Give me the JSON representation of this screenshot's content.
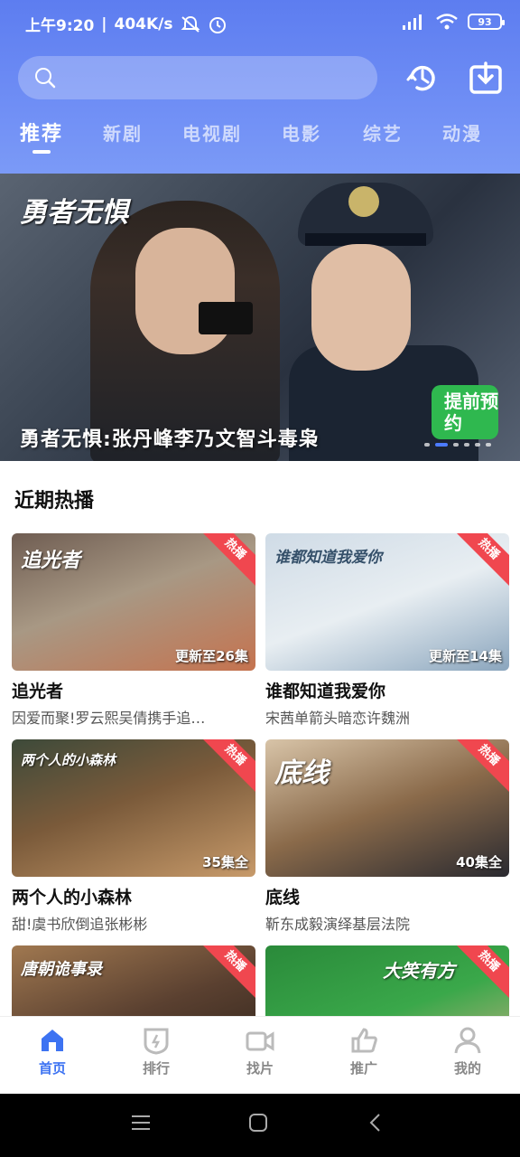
{
  "status_bar": {
    "time": "上午9:20",
    "network_speed": "404K/s",
    "battery": "93"
  },
  "search": {
    "placeholder": ""
  },
  "tabs": [
    {
      "label": "推荐",
      "active": true
    },
    {
      "label": "新剧",
      "active": false
    },
    {
      "label": "电视剧",
      "active": false
    },
    {
      "label": "电影",
      "active": false
    },
    {
      "label": "综艺",
      "active": false
    },
    {
      "label": "动漫",
      "active": false
    }
  ],
  "banner": {
    "logo_text": "勇者无惧",
    "title": "勇者无惧:张丹峰李乃文智斗毒枭",
    "stamp": "提前预约",
    "slide_count": 6,
    "active_slide": 2
  },
  "section": {
    "title": "近期热播"
  },
  "cards": [
    {
      "name": "追光者",
      "desc": "因爱而聚!罗云熙吴倩携手追…",
      "episode": "更新至26集",
      "hot": "热播",
      "logo": "追光者",
      "colors": [
        "#6f5d52",
        "#a89884",
        "#c5734f"
      ]
    },
    {
      "name": "谁都知道我爱你",
      "desc": "宋茜单箭头暗恋许魏洲",
      "episode": "更新至14集",
      "hot": "热播",
      "logo": "谁都知道我爱你",
      "colors": [
        "#cfdbe6",
        "#e8eef2",
        "#8aa5bd"
      ]
    },
    {
      "name": "两个人的小森林",
      "desc": "甜!虞书欣倒追张彬彬",
      "episode": "35集全",
      "hot": "热播",
      "logo": "两个人的小森林",
      "colors": [
        "#7a5a3a",
        "#c79a6a",
        "#3d4a3a"
      ]
    },
    {
      "name": "底线",
      "desc": "靳东成毅演绎基层法院",
      "episode": "40集全",
      "hot": "热播",
      "logo": "底线",
      "colors": [
        "#8a6a4a",
        "#d8c4a8",
        "#2a2a30"
      ]
    },
    {
      "name": "",
      "desc": "",
      "episode": "",
      "hot": "热播",
      "logo": "唐朝诡事录",
      "colors": [
        "#5a4030",
        "#a07850",
        "#2a2018"
      ]
    },
    {
      "name": "",
      "desc": "",
      "episode": "",
      "hot": "热播",
      "logo": "大笑有方",
      "colors": [
        "#2a8a3a",
        "#3aa84a",
        "#d8b08a"
      ]
    }
  ],
  "bottom_nav": [
    {
      "label": "首页",
      "icon": "home-icon",
      "active": true
    },
    {
      "label": "排行",
      "icon": "ranking-icon",
      "active": false
    },
    {
      "label": "找片",
      "icon": "video-camera-icon",
      "active": false
    },
    {
      "label": "推广",
      "icon": "thumbs-up-icon",
      "active": false
    },
    {
      "label": "我的",
      "icon": "user-icon",
      "active": false
    }
  ],
  "colors": {
    "accent": "#3d73f2",
    "header_top": "#5d7df0",
    "hot_badge": "#f0474f",
    "stamp": "#2fb84f"
  }
}
